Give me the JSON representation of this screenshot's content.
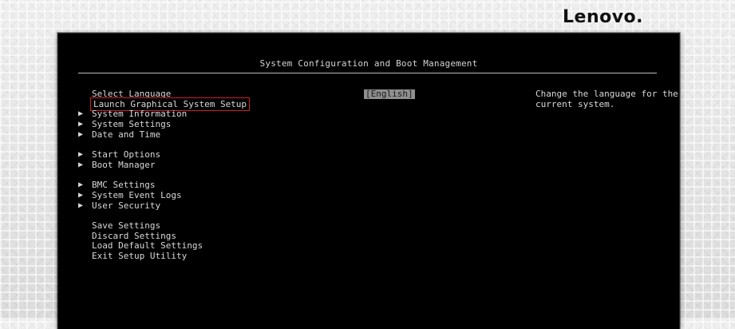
{
  "brand": {
    "logo_text": "Lenovo."
  },
  "window": {
    "title": "System Configuration and Boot Management"
  },
  "menu": {
    "items": [
      {
        "label": "Select Language",
        "has_submenu": false
      },
      {
        "label": "Launch Graphical System Setup",
        "has_submenu": false,
        "selected": true
      },
      {
        "label": "System Information",
        "has_submenu": true
      },
      {
        "label": "System Settings",
        "has_submenu": true
      },
      {
        "label": "Date and Time",
        "has_submenu": true
      },
      {
        "label": "Start Options",
        "has_submenu": true
      },
      {
        "label": "Boot Manager",
        "has_submenu": true
      },
      {
        "label": "BMC Settings",
        "has_submenu": true
      },
      {
        "label": "System Event Logs",
        "has_submenu": true
      },
      {
        "label": "User Security",
        "has_submenu": true
      },
      {
        "label": "Save Settings",
        "has_submenu": false
      },
      {
        "label": "Discard Settings",
        "has_submenu": false
      },
      {
        "label": "Load Default Settings",
        "has_submenu": false
      },
      {
        "label": "Exit Setup Utility",
        "has_submenu": false
      }
    ]
  },
  "language": {
    "value": "[English]"
  },
  "help": {
    "text": "Change the language for the current system."
  },
  "colors": {
    "window_background": "#000000",
    "text": "#d8d8d8",
    "selection_outline": "#cc1f2b",
    "value_highlight": "#8f8f8f"
  },
  "icons": {
    "submenu_marker": "triangle-right-icon"
  }
}
